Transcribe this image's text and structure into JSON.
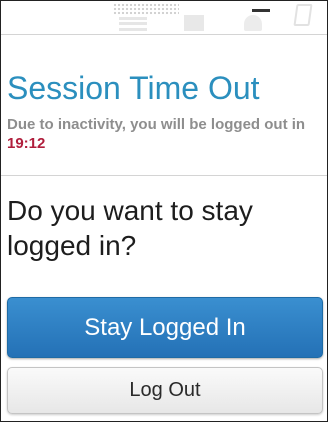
{
  "dialog": {
    "title": "Session Time Out",
    "message_prefix": "Due to inactivity, you will be logged out in",
    "countdown": "19:12",
    "question": "Do you want to stay logged in?",
    "stay_button_label": "Stay Logged In",
    "logout_button_label": "Log Out"
  },
  "background_toolbar": {
    "icons": [
      "menu-icon",
      "window-icon",
      "user-icon",
      "minimize-icon",
      "edit-icon"
    ]
  },
  "colors": {
    "title": "#2b8fbe",
    "countdown": "#b01e3c",
    "primary_button": "#2a7bbf",
    "secondary_button": "#efefef"
  }
}
